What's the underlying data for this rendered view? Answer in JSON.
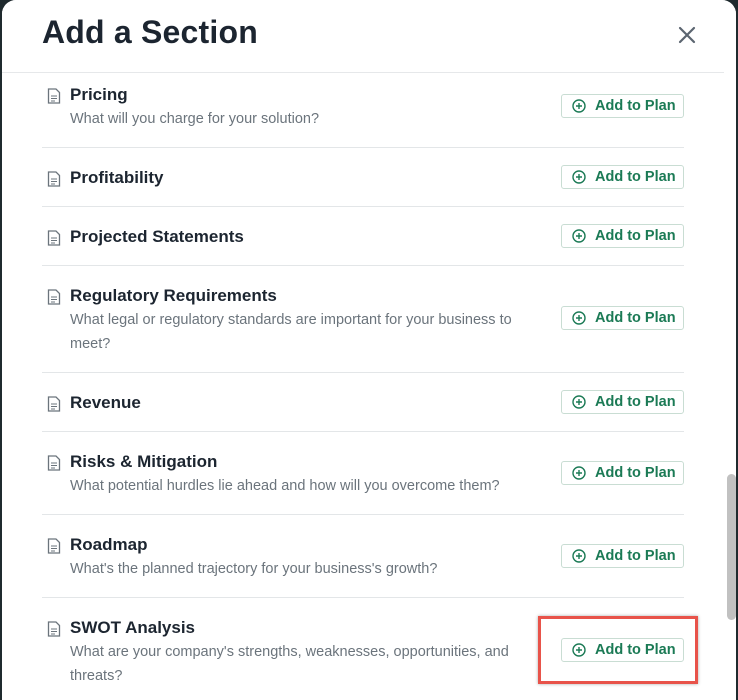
{
  "dialog": {
    "title": "Add a Section",
    "close_icon": "close-icon"
  },
  "sections": [
    {
      "title": "Pricing",
      "desc": "What will you charge for your solution?",
      "button": "Add to Plan"
    },
    {
      "title": "Profitability",
      "desc": "",
      "button": "Add to Plan"
    },
    {
      "title": "Projected Statements",
      "desc": "",
      "button": "Add to Plan"
    },
    {
      "title": "Regulatory Requirements",
      "desc": "What legal or regulatory standards are important for your business to meet?",
      "button": "Add to Plan"
    },
    {
      "title": "Revenue",
      "desc": "",
      "button": "Add to Plan"
    },
    {
      "title": "Risks & Mitigation",
      "desc": "What potential hurdles lie ahead and how will you overcome them?",
      "button": "Add to Plan"
    },
    {
      "title": "Roadmap",
      "desc": "What's the planned trajectory for your business's growth?",
      "button": "Add to Plan"
    },
    {
      "title": "SWOT Analysis",
      "desc": "What are your company's strengths, weaknesses, opportunities, and threats?",
      "button": "Add to Plan"
    }
  ],
  "colors": {
    "accent": "#1b7a55",
    "highlight": "#e8534a"
  }
}
